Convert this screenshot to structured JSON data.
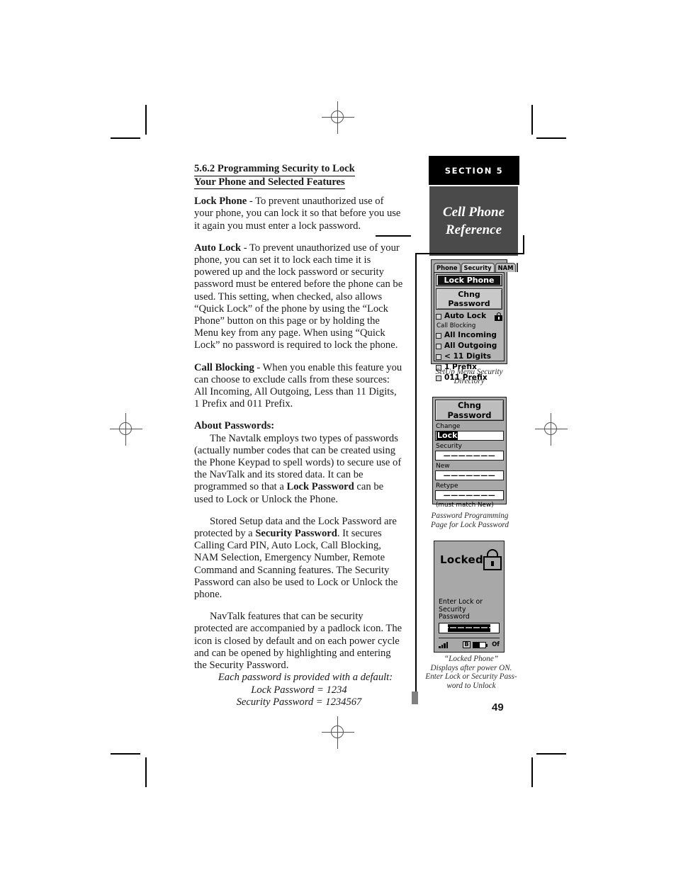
{
  "page": {
    "number": "49"
  },
  "section_banner": {
    "label": "SECTION 5",
    "title": "Cell Phone\nReference",
    "title_line1": "Cell Phone",
    "title_line2": "Reference",
    "band_color": "#000000",
    "box_color": "#4a4a4a",
    "text_color": "#ffffff"
  },
  "article": {
    "heading_line1": "5.6.2  Programming Security to Lock",
    "heading_line2": "Your Phone and Selected Features",
    "p1_bold": "Lock Phone",
    "p1_text": " - To prevent unauthorized use of your phone, you can lock it so that before you use it again you must enter a lock password.",
    "p2_bold": "Auto Lock",
    "p2_text": " - To prevent unauthorized use of your phone, you can set it to lock each time it is powered up and the lock password or security password must be entered before the phone can be used. This setting, when checked, also allows “Quick Lock” of the phone by using the “Lock Phone” button on this page or by holding the Menu key from any page. When using “Quick Lock” no password is required to lock the phone.",
    "p3_bold": "Call Blocking",
    "p3_text": " - When you enable this feature you can choose to exclude calls from these sources: All Incoming, All Outgoing, Less than 11 Digits, 1 Prefix and 011 Prefix.",
    "about_heading": "About Passwords:",
    "p4_a": "The Navtalk employs two types of passwords (actually number codes that can be created using the Phone Keypad to spell words) to secure use of the NavTalk and its stored data. It can be programmed so that a ",
    "p4_bold": "Lock Password",
    "p4_b": " can be used to Lock or Unlock the Phone.",
    "p5_a": "Stored Setup data and the Lock Password are protected by a ",
    "p5_bold": "Security Password",
    "p5_b": ". It secures Calling Card PIN, Auto Lock, Call Blocking, NAM Selection, Emergency Number, Remote Command and Scanning features. The Security Password can also be used to Lock or Unlock the phone.",
    "p6": "NavTalk features that can be security protected are accompanied by a padlock icon. The icon is closed by default and on each power cycle and can be opened by highlighting and entering the Security Password.",
    "defaults_intro": "Each password is provided with a default:",
    "defaults_lock": "Lock Password = 1234",
    "defaults_security": "Security Password = 1234567"
  },
  "device_security": {
    "tabs": [
      {
        "label": "Phone",
        "active": false
      },
      {
        "label": "Security",
        "active": true
      },
      {
        "label": "NAM",
        "active": false
      }
    ],
    "lock_phone_button": "Lock Phone",
    "chng_password_button": "Chng Password",
    "auto_lock_label": "Auto Lock",
    "auto_lock_checked": false,
    "call_blocking_label": "Call Blocking",
    "call_blocking_items": [
      {
        "label": "All Incoming",
        "checked": false
      },
      {
        "label": "All Outgoing",
        "checked": false
      },
      {
        "label": "< 11 Digits",
        "checked": false
      },
      {
        "label": "1 Prefix",
        "checked": false
      },
      {
        "label": "011 Prefix",
        "checked": false
      }
    ],
    "caption_line1": "SetUp Menu Security",
    "caption_line2": "Directory"
  },
  "device_password": {
    "title": "Chng Password",
    "change_label": "Change",
    "change_value": "Lock",
    "security_label": "Security",
    "security_value": "———————",
    "new_label": "New",
    "new_value": "———————",
    "retype_label": "Retype",
    "retype_value": "———————",
    "hint": "(must match New)",
    "caption_line1": "Password Programming",
    "caption_line2": "Page for Lock Password"
  },
  "device_locked": {
    "title": "Locked",
    "prompt_line1": "Enter Lock or Security",
    "prompt_line2": "Password",
    "password_value": "———————",
    "status_roam": "B",
    "status_off": "Of",
    "signal_bars": 4,
    "battery_level": 52,
    "caption_line1": "“Locked Phone”",
    "caption_line2": "Displays after power ON.",
    "caption_line3": "Enter Lock  or Security Pass-",
    "caption_line4": "word to Unlock"
  }
}
